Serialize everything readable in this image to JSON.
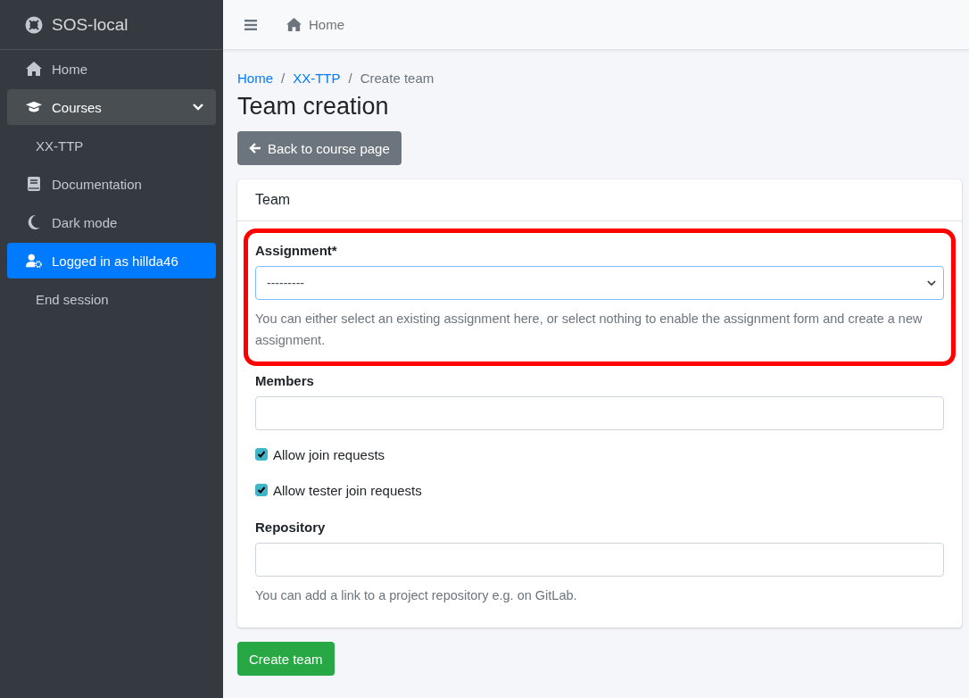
{
  "brand": {
    "title": "SOS-local"
  },
  "sidebar": {
    "items": [
      {
        "kind": "home",
        "label": "Home",
        "selected": false
      },
      {
        "kind": "courses",
        "label": "Courses",
        "selected": false,
        "expanded": true
      },
      {
        "kind": "sub",
        "label": "XX-TTP",
        "selected": false
      },
      {
        "kind": "docs",
        "label": "Documentation",
        "selected": false
      },
      {
        "kind": "moon",
        "label": "Dark mode",
        "selected": false
      },
      {
        "kind": "user",
        "label": "Logged in as hillda46",
        "selected": true
      },
      {
        "kind": "sub",
        "label": "End session",
        "selected": false
      }
    ]
  },
  "topbar": {
    "home_link": "Home"
  },
  "breadcrumb": [
    {
      "label": "Home",
      "link": true
    },
    {
      "label": "XX-TTP",
      "link": true
    },
    {
      "label": "Create team",
      "link": false
    }
  ],
  "separator": "/",
  "page_title": "Team creation",
  "back_button": "Back to course page",
  "card": {
    "header": "Team"
  },
  "assignment": {
    "label": "Assignment*",
    "value": "---------",
    "help": "You can either select an existing assignment here, or select nothing to enable the assignment form and create a new assignment.",
    "highlighted": true
  },
  "members": {
    "label": "Members"
  },
  "checkboxes": [
    {
      "label": "Allow join requests",
      "checked": true
    },
    {
      "label": "Allow tester join requests",
      "checked": true
    }
  ],
  "repository": {
    "label": "Repository",
    "help": "You can add a link to a project repository e.g. on GitLab."
  },
  "submit_button": "Create team"
}
